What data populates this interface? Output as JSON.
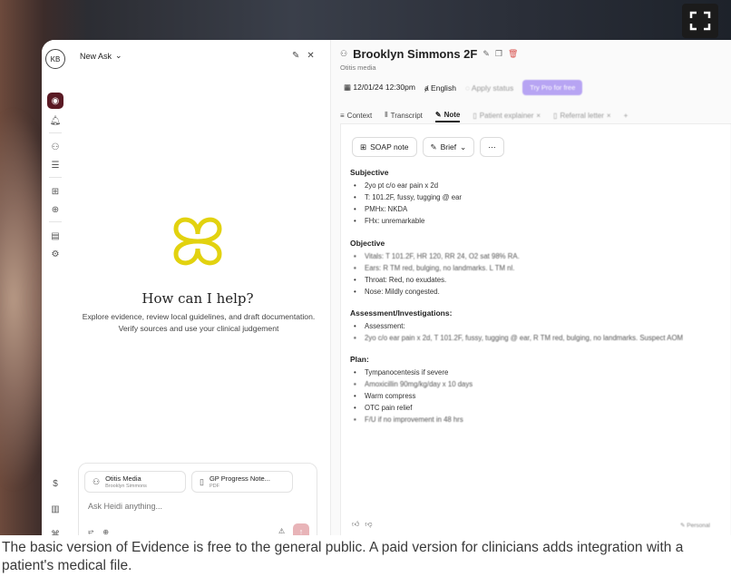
{
  "left_panel": {
    "avatar": "KB",
    "new_ask": "New Ask",
    "heading": "How can I help?",
    "subtext": "Explore evidence, review local guidelines, and draft documentation. Verify sources and use your clinical judgement",
    "chips": [
      {
        "title": "Otitis Media",
        "subtitle": "Brooklyn Simmons"
      },
      {
        "title": "GP Progress Note...",
        "subtitle": "PDF"
      }
    ],
    "input_placeholder": "Ask Heidi anything..."
  },
  "right_panel": {
    "patient_title": "Brooklyn Simmons 2F",
    "subtitle": "Otitis media",
    "datetime": "12/01/24 12:30pm",
    "language": "English",
    "apply_status": "Apply status",
    "pro_button": "Try Pro for free",
    "tabs": [
      "Context",
      "Transcript",
      "Note",
      "Patient explainer",
      "Referral letter"
    ],
    "note_type": "SOAP note",
    "length": "Brief",
    "sections": [
      {
        "heading": "Subjective",
        "items": [
          "2yo pt c/o ear pain x 2d",
          "T: 101.2F, fussy, tugging @ ear",
          "PMHx: NKDA",
          "FHx: unremarkable"
        ]
      },
      {
        "heading": "Objective",
        "items": [
          "Vitals: T 101.2F, HR 120, RR 24, O2 sat 98% RA.",
          "Ears: R TM red, bulging, no landmarks. L TM nl.",
          "Throat: Red, no exudates.",
          "Nose: Mildly congested."
        ]
      },
      {
        "heading": "Assessment/Investigations:",
        "items": [
          "Assessment:",
          "2yo c/o ear pain x 2d, T 101.2F, fussy, tugging @ ear, R TM red, bulging, no landmarks. Suspect AOM"
        ]
      },
      {
        "heading": "Plan:",
        "items": [
          "Tympanocentesis if severe",
          "Amoxicillin 90mg/kg/day x 10 days",
          "Warm compress",
          "OTC pain relief",
          "F/U if no improvement in 48 hrs"
        ]
      }
    ],
    "personal": "Personal"
  },
  "caption": "The basic version of Evidence is free to the general public. A paid version for clinicians adds integration with a patient's medical file."
}
